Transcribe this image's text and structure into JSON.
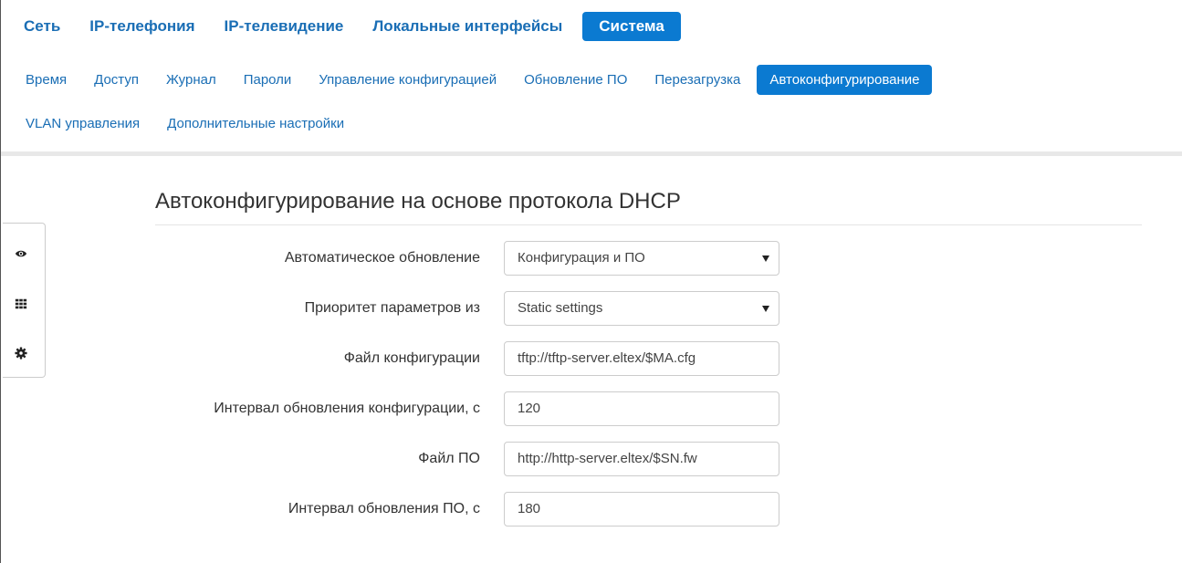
{
  "top_nav": [
    {
      "label": "Сеть",
      "active": false
    },
    {
      "label": "IP-телефония",
      "active": false
    },
    {
      "label": "IP-телевидение",
      "active": false
    },
    {
      "label": "Локальные интерфейсы",
      "active": false
    },
    {
      "label": "Система",
      "active": true
    }
  ],
  "sub_nav": [
    {
      "label": "Время",
      "active": false
    },
    {
      "label": "Доступ",
      "active": false
    },
    {
      "label": "Журнал",
      "active": false
    },
    {
      "label": "Пароли",
      "active": false
    },
    {
      "label": "Управление конфигурацией",
      "active": false
    },
    {
      "label": "Обновление ПО",
      "active": false
    },
    {
      "label": "Перезагрузка",
      "active": false
    },
    {
      "label": "Автоконфигурирование",
      "active": true
    },
    {
      "label": "VLAN управления",
      "active": false
    },
    {
      "label": "Дополнительные настройки",
      "active": false
    }
  ],
  "side_tools": [
    {
      "icon": "eye-icon"
    },
    {
      "icon": "grid-icon"
    },
    {
      "icon": "gear-icon"
    }
  ],
  "section": {
    "title": "Автоконфигурирование на основе протокола DHCP"
  },
  "form": {
    "auto_update": {
      "label": "Автоматическое обновление",
      "value": "Конфигурация и ПО"
    },
    "priority": {
      "label": "Приоритет параметров из",
      "value": "Static settings"
    },
    "config_file": {
      "label": "Файл конфигурации",
      "value": "tftp://tftp-server.eltex/$MA.cfg"
    },
    "config_interval": {
      "label": "Интервал обновления конфигурации, с",
      "value": "120"
    },
    "fw_file": {
      "label": "Файл ПО",
      "value": "http://http-server.eltex/$SN.fw"
    },
    "fw_interval": {
      "label": "Интервал обновления ПО, с",
      "value": "180"
    }
  },
  "colors": {
    "accent": "#0b7ad1",
    "link": "#1a6eb5"
  }
}
